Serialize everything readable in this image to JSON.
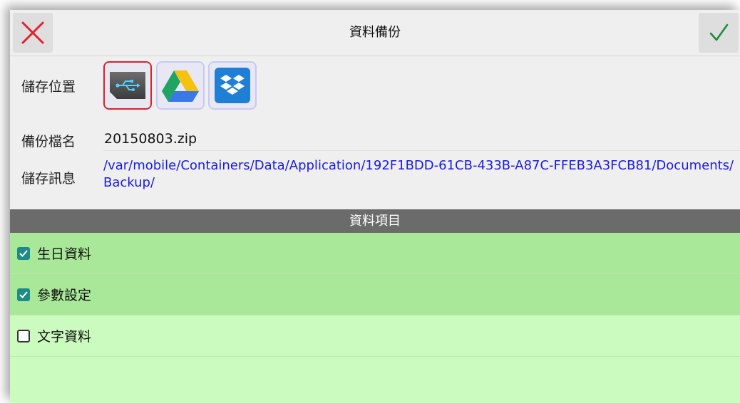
{
  "window": {
    "title": "資料備份",
    "cancel_icon": "close-x-icon",
    "confirm_icon": "checkmark-icon",
    "cancel_color": "#e0212f",
    "confirm_color": "#1e8c3a"
  },
  "storage": {
    "label": "儲存位置",
    "options": [
      {
        "name": "local-sd-card",
        "icon": "sd-card-usb-icon",
        "selected": true
      },
      {
        "name": "google-drive",
        "icon": "google-drive-icon",
        "selected": false
      },
      {
        "name": "dropbox",
        "icon": "dropbox-icon",
        "selected": false
      }
    ]
  },
  "backup": {
    "filename_label": "備份檔名",
    "filename": "20150803.zip",
    "info_label": "儲存訊息",
    "path": "/var/mobile/Containers/Data/Application/192F1BDD-61CB-433B-A87C-FFEB3A3FCB81/Documents/Backup/"
  },
  "items_section": {
    "header": "資料項目",
    "items": [
      {
        "label": "生日資料",
        "checked": true
      },
      {
        "label": "參數設定",
        "checked": true
      },
      {
        "label": "文字資料",
        "checked": false
      }
    ]
  },
  "colors": {
    "checked_row": "#a8e898",
    "unchecked_row": "#ccfbbf",
    "header_bg": "#6b6b6b",
    "path_link": "#1a1ae6",
    "selected_border": "#d9232e"
  }
}
